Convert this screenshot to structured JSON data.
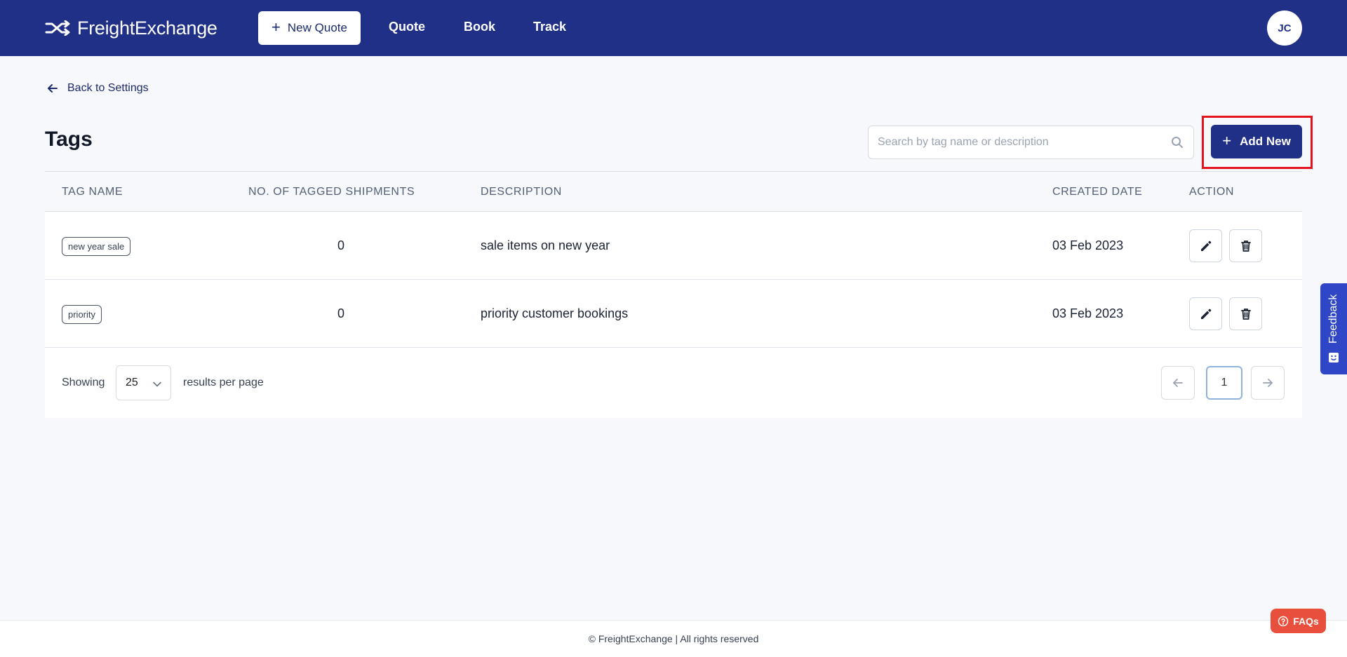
{
  "header": {
    "brand": "FreightExchange",
    "new_quote_label": "New Quote",
    "nav": [
      "Quote",
      "Book",
      "Track"
    ],
    "avatar_initials": "JC"
  },
  "back_link": "Back to Settings",
  "page_title": "Tags",
  "search": {
    "placeholder": "Search by tag name or description"
  },
  "add_new_label": "Add New",
  "table": {
    "columns": [
      "TAG NAME",
      "NO. OF TAGGED SHIPMENTS",
      "DESCRIPTION",
      "CREATED DATE",
      "ACTION"
    ],
    "rows": [
      {
        "tag": "new year sale",
        "count": "0",
        "description": "sale items on new year",
        "created": "03 Feb 2023"
      },
      {
        "tag": "priority",
        "count": "0",
        "description": "priority customer bookings",
        "created": "03 Feb 2023"
      }
    ]
  },
  "pagination": {
    "showing_label": "Showing",
    "per_page": "25",
    "results_label": "results per page",
    "current_page": "1"
  },
  "feedback_label": "Feedback",
  "footer": {
    "copyright": "© FreightExchange | All rights reserved"
  },
  "faq_label": "FAQs",
  "colors": {
    "brand": "#213087",
    "highlight": "#e3141f",
    "faq": "#e8503d",
    "feedback": "#2f47c7"
  }
}
